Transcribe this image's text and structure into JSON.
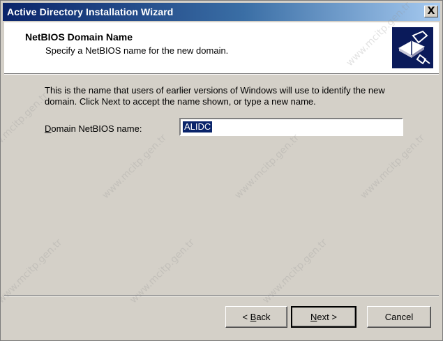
{
  "window": {
    "title": "Active Directory Installation Wizard",
    "close_label": "X"
  },
  "header": {
    "title": "NetBIOS Domain Name",
    "subtitle": "Specify a NetBIOS name for the new domain.",
    "icon": "wizard-book-icon"
  },
  "body": {
    "description": "This is the name that users of earlier versions of Windows will use to identify the new domain. Click Next to accept the name shown, or type a new name.",
    "field_label_mnemonic": "D",
    "field_label_rest": "omain NetBIOS name:",
    "field_value": "ALIDC"
  },
  "buttons": {
    "back_prefix": "< ",
    "back_mnemonic": "B",
    "back_rest": "ack",
    "next_mnemonic": "N",
    "next_rest": "ext >",
    "cancel": "Cancel"
  },
  "watermark": {
    "text": "www.mcitp.gen.tr"
  },
  "colors": {
    "title_bar_start": "#0a246a",
    "title_bar_end": "#a6caf0",
    "dialog_face": "#d4d0c8",
    "selection": "#0a246a"
  }
}
